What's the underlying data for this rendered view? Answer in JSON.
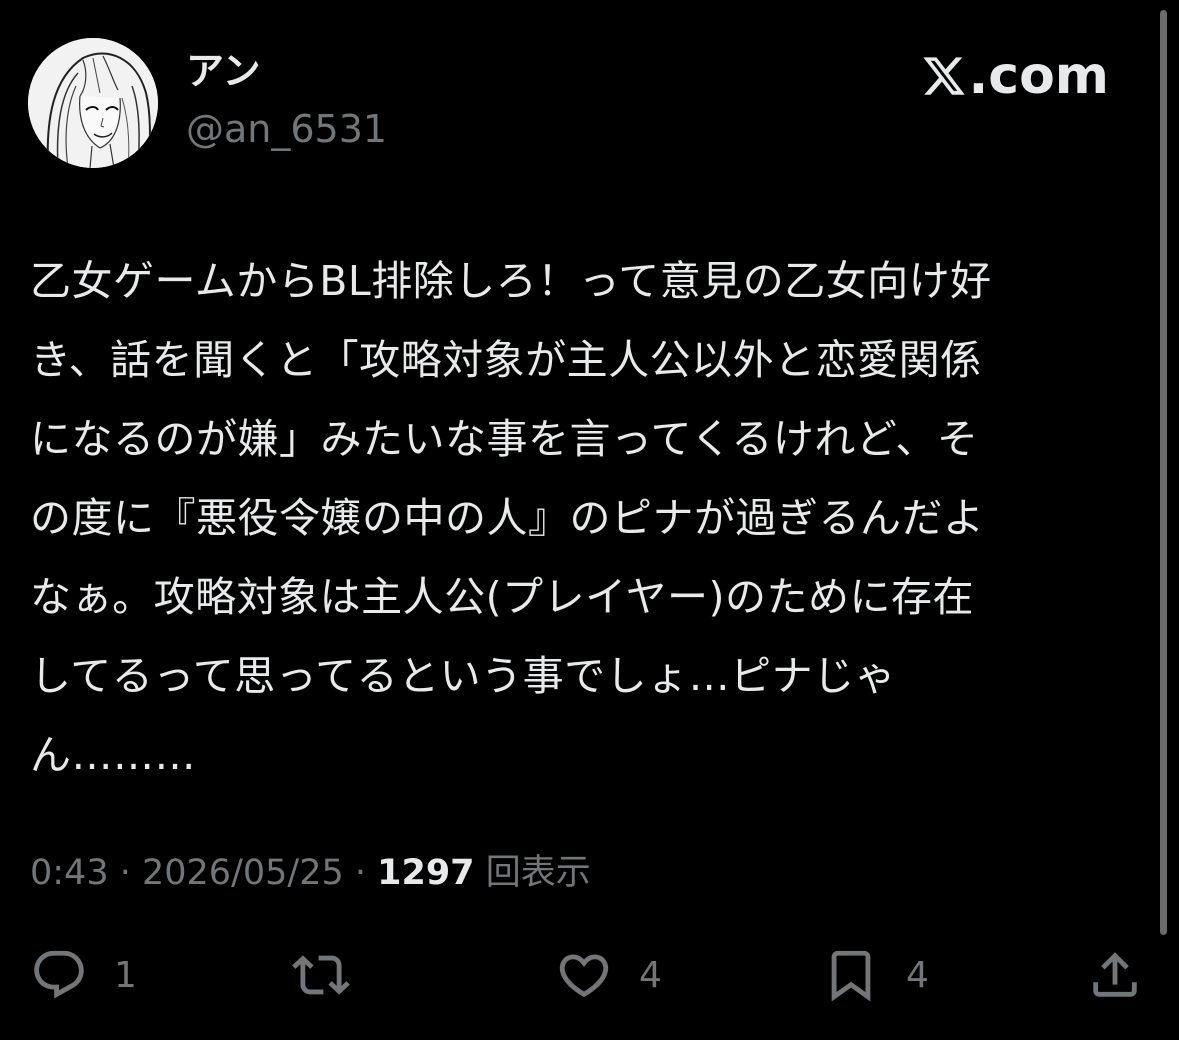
{
  "author": {
    "display_name": "アン",
    "handle": "@an_6531"
  },
  "brand": {
    "label": ".com",
    "icon": "x-logo-icon"
  },
  "tweet": {
    "text": "乙女ゲームからBL排除しろ！って意見の乙女向け好\nき、話を聞くと「攻略対象が主人公以外と恋愛関係\nになるのが嫌」みたいな事を言ってくるけれど、そ\nの度に『悪役令嬢の中の人』のピナが過ぎるんだよ\nなぁ。攻略対象は主人公(プレイヤー)のために存在\nしてるって思ってるという事でしょ…ピナじゃ\nん………",
    "time": "0:43",
    "separator": " · ",
    "date": "2026/05/25",
    "views_count": "1297",
    "views_label": "回表示"
  },
  "actions": {
    "reply": {
      "icon": "reply-icon",
      "count": "1"
    },
    "retweet": {
      "icon": "retweet-icon",
      "count": ""
    },
    "like": {
      "icon": "heart-icon",
      "count": "4"
    },
    "bookmark": {
      "icon": "bookmark-icon",
      "count": "4"
    },
    "share": {
      "icon": "share-icon",
      "count": ""
    }
  },
  "colors": {
    "background": "#000000",
    "primary_text": "#e7e9ea",
    "secondary_text": "#71767b"
  }
}
